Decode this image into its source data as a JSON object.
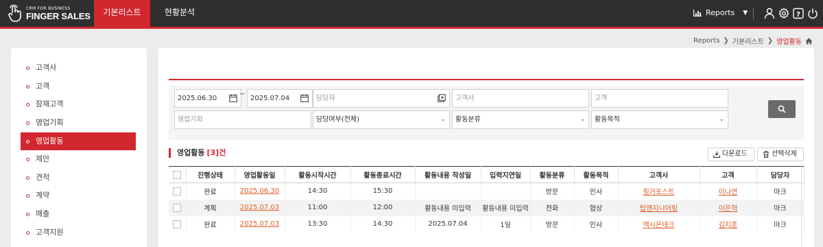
{
  "header": {
    "logo_small": "CRM FOR BUSINESS",
    "logo_big": "FINGER SALES",
    "tabs": [
      {
        "label": "기본리스트",
        "active": true
      },
      {
        "label": "현황분석",
        "active": false
      }
    ],
    "reports_label": "Reports",
    "icons": [
      "user-icon",
      "gear-icon",
      "help-icon",
      "power-icon"
    ]
  },
  "breadcrumb": {
    "items": [
      "Reports",
      "기본리스트"
    ],
    "current": "영업활동",
    "home_icon": "home-icon"
  },
  "sidebar": {
    "items": [
      {
        "label": "고객사",
        "active": false
      },
      {
        "label": "고객",
        "active": false
      },
      {
        "label": "잠재고객",
        "active": false
      },
      {
        "label": "영업기회",
        "active": false
      },
      {
        "label": "영업활동",
        "active": true
      },
      {
        "label": "제안",
        "active": false
      },
      {
        "label": "견적",
        "active": false
      },
      {
        "label": "계약",
        "active": false
      },
      {
        "label": "매출",
        "active": false
      },
      {
        "label": "고객지원",
        "active": false
      }
    ]
  },
  "filters": {
    "date_from": "2025.06.30",
    "date_sep": "~",
    "date_to": "2025.07.04",
    "owner_placeholder": "담당자",
    "customer_company_placeholder": "고객사",
    "customer_placeholder": "고객",
    "opportunity_placeholder": "영업기회",
    "owner_select": "담당여부(전체)",
    "activity_type_select": "활동분류",
    "activity_purpose_select": "활동목적"
  },
  "section": {
    "title": "영업활동",
    "count": "[3]건",
    "download_label": "다운로드",
    "delete_label": "선택삭제"
  },
  "table": {
    "columns": [
      "",
      "진행상태",
      "영업활동일",
      "활동시작시간",
      "활동종료시간",
      "활동내용 작성일",
      "입력지연일",
      "활동분류",
      "활동목적",
      "고객사",
      "고객",
      "담당자"
    ],
    "rows": [
      {
        "status": "완료",
        "date": "2025.06.30",
        "start": "14:30",
        "end": "15:30",
        "written": "",
        "delay": "",
        "type": "방문",
        "purpose": "인사",
        "company": "핑거포스트",
        "customer": "이나연",
        "owner": "마크"
      },
      {
        "status": "계획",
        "date": "2025.07.03",
        "start": "11:00",
        "end": "12:00",
        "written": "활동내용 미입력",
        "delay": "활동내용 미입력",
        "type": "전화",
        "purpose": "협상",
        "company": "탑엔지니어링",
        "customer": "이은혁",
        "owner": "마크"
      },
      {
        "status": "완료",
        "date": "2025.07.03",
        "start": "13:30",
        "end": "14:30",
        "written": "2025.07.04",
        "delay": "1일",
        "type": "방문",
        "purpose": "인사",
        "company": "엑시온테크",
        "customer": "김지훈",
        "owner": "마크"
      }
    ]
  },
  "colors": {
    "accent": "#d2272e",
    "topbar": "#2f2f2f",
    "link": "#e05a1f"
  }
}
